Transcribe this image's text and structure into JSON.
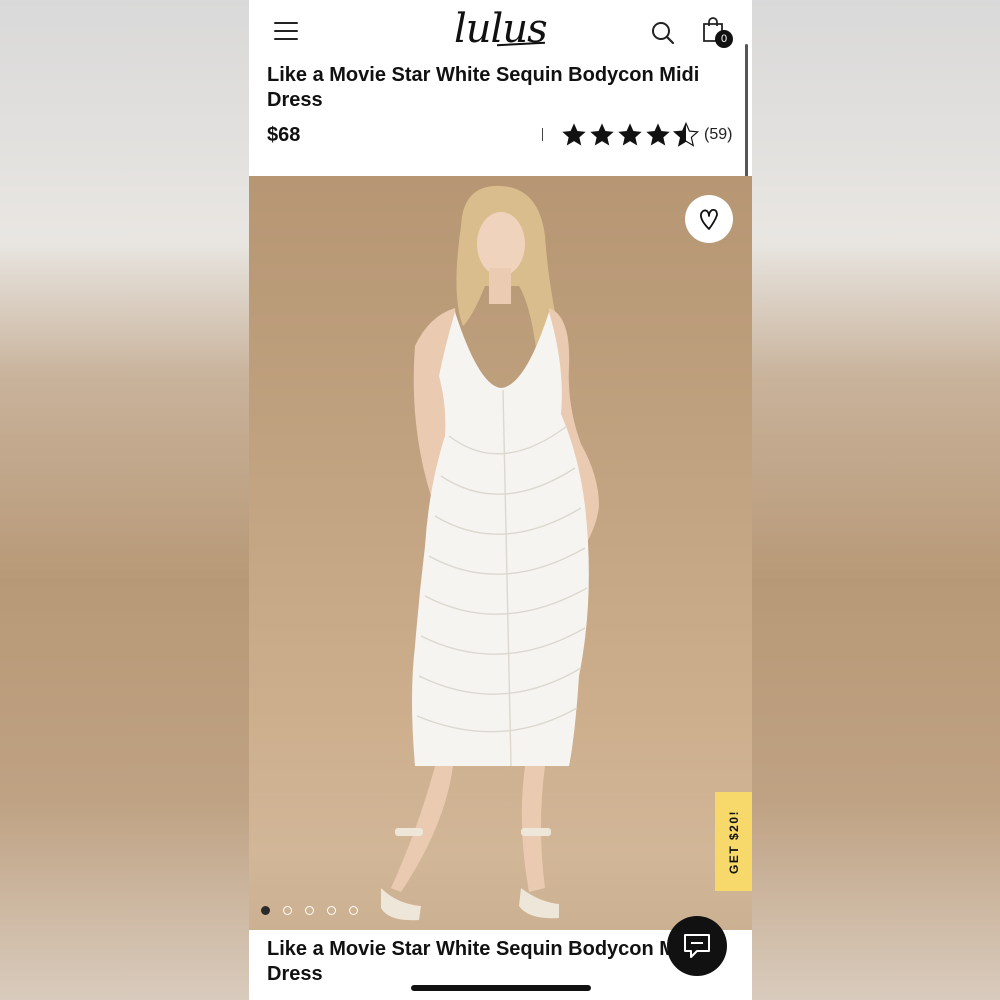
{
  "header": {
    "logo_text": "lulus",
    "cart_count": "0",
    "icons": {
      "menu": "hamburger-icon",
      "search": "search-icon",
      "cart": "shopping-bag-icon"
    }
  },
  "product": {
    "title": "Like a Movie Star White Sequin Bodycon Midi Dress",
    "price": "$68",
    "rating": 4.5,
    "rating_max": 5,
    "review_count": "(59)",
    "separator": "|"
  },
  "gallery": {
    "image_count": 5,
    "active_index": 0,
    "favorite_icon": "heart-icon",
    "background_color": "#c3a583",
    "dress_color": "#f5f3ef"
  },
  "promo": {
    "label": "GET $20!",
    "color": "#f7d86a"
  },
  "chat": {
    "icon": "chat-icon"
  },
  "below_fold": {
    "title": "Like a Movie Star White Sequin Bodycon Midi Dress"
  }
}
